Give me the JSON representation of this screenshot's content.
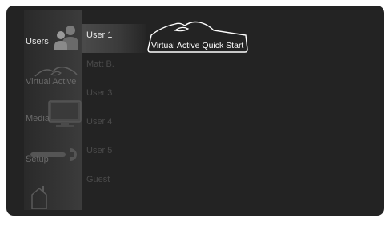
{
  "sidebar": {
    "items": [
      {
        "label": "Users",
        "icon": "users-icon"
      },
      {
        "label": "Virtual Active",
        "icon": "virtual-active-logo-icon"
      },
      {
        "label": "Media",
        "icon": "monitor-icon"
      },
      {
        "label": "Setup",
        "icon": "wrench-icon"
      },
      {
        "label": "",
        "icon": "home-icon"
      }
    ]
  },
  "users": {
    "list": [
      "User 1",
      "Matt B.",
      "User 3",
      "User 4",
      "User 5",
      "Guest"
    ],
    "selected": "User 1"
  },
  "quickstart": {
    "label": "Virtual Active Quick Start",
    "icon": "virtual-active-logo-icon"
  },
  "colors": {
    "background": "#232323",
    "highlight": "#4b4b4b",
    "text_active": "#e8e8e8",
    "text_inactive": "#4a4a4a"
  }
}
